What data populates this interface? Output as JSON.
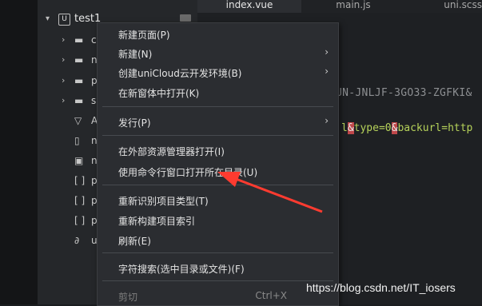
{
  "tabs": [
    {
      "label": "index.vue"
    },
    {
      "label": "main.js"
    },
    {
      "label": "uni.scss"
    }
  ],
  "project": {
    "name": "test1",
    "icon": "U"
  },
  "tree": [
    {
      "letter": "c",
      "icon": "folder-icon"
    },
    {
      "letter": "n",
      "icon": "folder-icon"
    },
    {
      "letter": "p",
      "icon": "folder-icon"
    },
    {
      "letter": "s",
      "icon": "folder-icon"
    },
    {
      "letter": "A",
      "icon": "vue-file-icon"
    },
    {
      "letter": "n",
      "icon": "file-icon"
    },
    {
      "letter": "n",
      "icon": "json-file-icon"
    },
    {
      "letter": "p",
      "icon": "bracket-file-icon"
    },
    {
      "letter": "p",
      "icon": "bracket-file-icon"
    },
    {
      "letter": "p",
      "icon": "bracket-file-icon"
    },
    {
      "letter": "u",
      "icon": "link-icon"
    }
  ],
  "editor": {
    "line1": "UN-JNLJF-3GO33-ZGFKI&",
    "line2_pre": "l",
    "line2_amp1": "&",
    "line2_mid": "type=0",
    "line2_amp2": "&",
    "line2_post": "backurl=http"
  },
  "menu": {
    "items": [
      {
        "label": "新建页面(P)",
        "submenu": false
      },
      {
        "label": "新建(N)",
        "submenu": true
      },
      {
        "label": "创建uniCloud云开发环境(B)",
        "submenu": true
      },
      {
        "label": "在新窗体中打开(K)",
        "submenu": false
      },
      {
        "label": "发行(P)",
        "submenu": true
      },
      {
        "label": "在外部资源管理器打开(I)",
        "submenu": false
      },
      {
        "label": "使用命令行窗口打开所在目录(U)",
        "submenu": false
      },
      {
        "label": "重新识别项目类型(T)",
        "submenu": false
      },
      {
        "label": "重新构建项目索引",
        "submenu": false
      },
      {
        "label": "刷新(E)",
        "submenu": false
      },
      {
        "label": "字符搜索(选中目录或文件)(F)",
        "submenu": false
      },
      {
        "label": "剪切",
        "shortcut": "Ctrl+X",
        "disabled": true
      }
    ],
    "submenu_glyph": "›"
  },
  "watermark": "https://blog.csdn.net/IT_iosers",
  "colors": {
    "annotation_arrow": "#ff3b30",
    "menu_bg": "#2b2d31",
    "sidebar_bg": "#25272a"
  }
}
